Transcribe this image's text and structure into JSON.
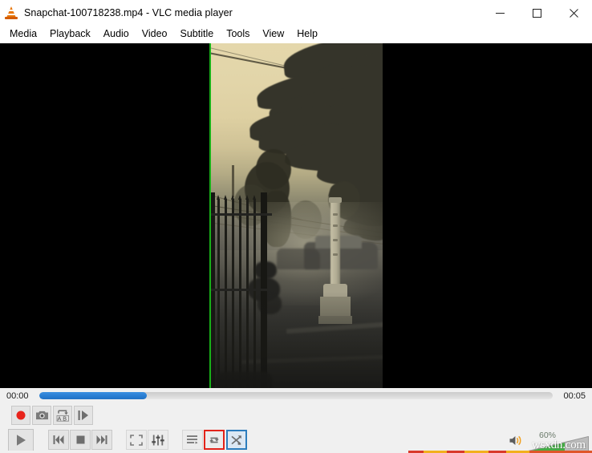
{
  "window": {
    "title": "Snapchat-100718238.mp4 - VLC media player",
    "app_icon": "vlc-cone-icon",
    "controls": {
      "minimize": "minimize-icon",
      "maximize": "maximize-icon",
      "close": "close-icon"
    }
  },
  "menubar": {
    "items": [
      {
        "label": "Media"
      },
      {
        "label": "Playback"
      },
      {
        "label": "Audio"
      },
      {
        "label": "Video"
      },
      {
        "label": "Subtitle"
      },
      {
        "label": "Tools"
      },
      {
        "label": "View"
      },
      {
        "label": "Help"
      }
    ]
  },
  "video": {
    "scene_description": "Foggy sepia-toned street scene with silhouetted conifer trees, power lines, an iron spear-top fence on the left, a parked car and a roadside milestone pole",
    "letterbox_color": "#000000",
    "selection_edge_color": "#18b018"
  },
  "seek": {
    "elapsed": "00:00",
    "total": "00:05",
    "progress_percent": 21,
    "fill_color": "#2a7fd4",
    "track_color": "#d9d9d9"
  },
  "toolbar": {
    "extended_row": [
      {
        "name": "record-button",
        "icon": "record-icon",
        "label": "Record"
      },
      {
        "name": "snapshot-button",
        "icon": "camera-icon",
        "label": "Take a snapshot"
      },
      {
        "name": "ab-loop-button",
        "icon": "ab-loop-icon",
        "label": "Loop from point A to point B continuously"
      },
      {
        "name": "frame-by-frame-button",
        "icon": "frame-step-icon",
        "label": "Frame by frame"
      }
    ],
    "main_row": [
      {
        "name": "play-button",
        "icon": "play-icon",
        "label": "Play"
      },
      {
        "name": "previous-button",
        "icon": "skip-previous-icon",
        "label": "Previous media in the playlist"
      },
      {
        "name": "stop-button",
        "icon": "stop-icon",
        "label": "Stop playback"
      },
      {
        "name": "next-button",
        "icon": "skip-next-icon",
        "label": "Next media in the playlist"
      },
      {
        "name": "fullscreen-button",
        "icon": "fullscreen-icon",
        "label": "Toggle the video in fullscreen"
      },
      {
        "name": "extended-settings-button",
        "icon": "equalizer-icon",
        "label": "Show extended settings"
      },
      {
        "name": "playlist-button",
        "icon": "playlist-icon",
        "label": "Show playlist"
      },
      {
        "name": "loop-button",
        "icon": "loop-icon",
        "label": "Click to toggle between loop all, loop one and no loop",
        "highlight": "red"
      },
      {
        "name": "shuffle-button",
        "icon": "shuffle-icon",
        "label": "Random",
        "highlight": "blue"
      }
    ]
  },
  "volume": {
    "icon": "speaker-icon",
    "percent_label": "60%",
    "value": 60,
    "fill_color": "#45b045",
    "track_color": "#bcbcbc"
  },
  "watermark": {
    "text": "wsxdn.com"
  },
  "colors": {
    "chrome_background": "#f0f0f0",
    "titlebar_background": "#ffffff",
    "accent_blue": "#2a7fd4",
    "highlight_red": "#e2231a",
    "highlight_blue": "#2d7dbd"
  }
}
